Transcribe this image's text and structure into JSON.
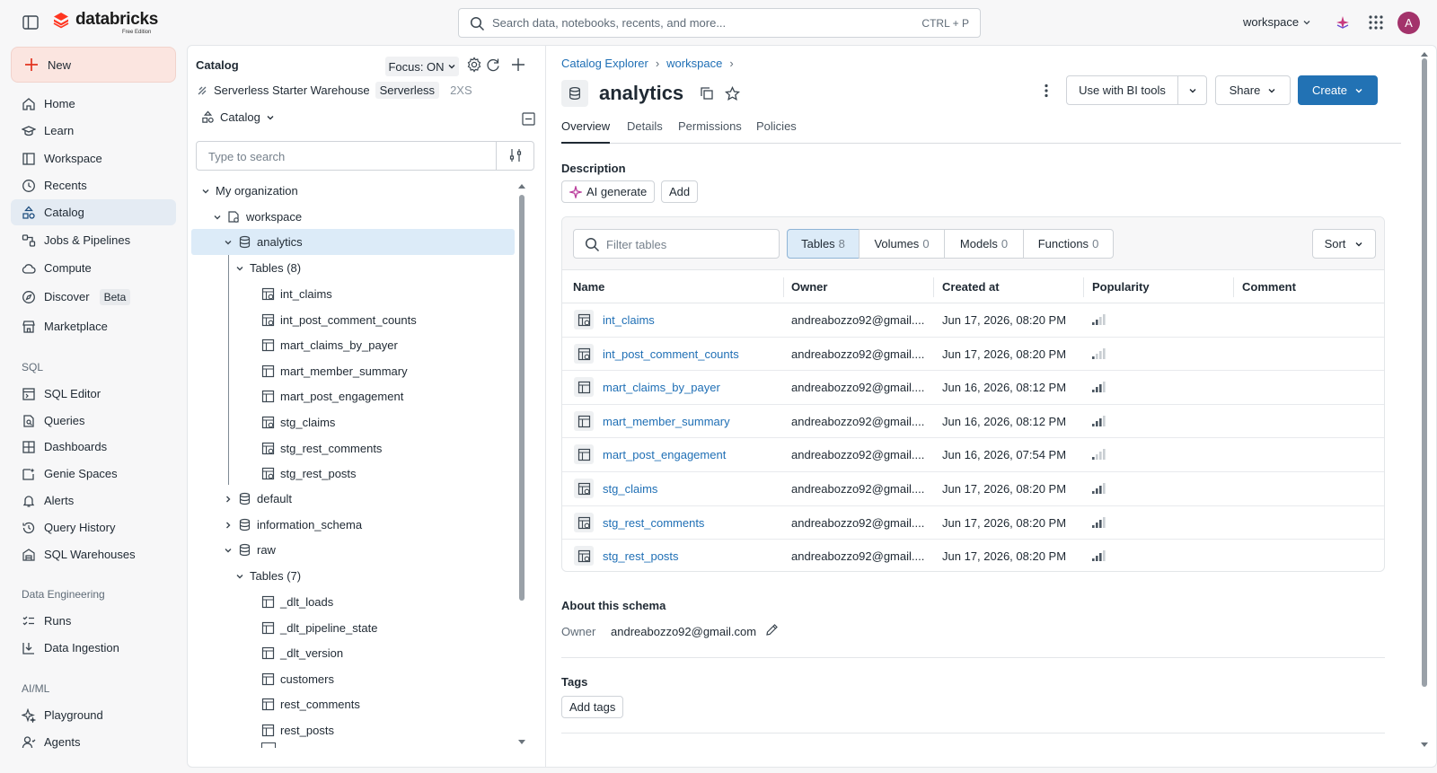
{
  "app": {
    "brand": "databricks",
    "edition": "Free Edition",
    "search_placeholder": "Search data, notebooks, recents, and more...",
    "search_shortcut": "CTRL + P",
    "workspace_label": "workspace",
    "avatar_initial": "A",
    "accent_color": "#2272b4",
    "brand_color": "#ff3621"
  },
  "leftnav": {
    "new_label": "New",
    "items": [
      {
        "label": "Home",
        "icon": "home-icon"
      },
      {
        "label": "Learn",
        "icon": "learn-icon"
      },
      {
        "label": "Workspace",
        "icon": "workspace-icon"
      },
      {
        "label": "Recents",
        "icon": "clock-icon"
      },
      {
        "label": "Catalog",
        "icon": "catalog-icon",
        "active": true
      },
      {
        "label": "Jobs & Pipelines",
        "icon": "jobs-icon"
      },
      {
        "label": "Compute",
        "icon": "cloud-icon"
      },
      {
        "label": "Discover",
        "icon": "compass-icon",
        "badge": "Beta"
      },
      {
        "label": "Marketplace",
        "icon": "store-icon"
      }
    ],
    "sql_section": "SQL",
    "sql_items": [
      {
        "label": "SQL Editor",
        "icon": "sql-editor-icon"
      },
      {
        "label": "Queries",
        "icon": "queries-icon"
      },
      {
        "label": "Dashboards",
        "icon": "dashboard-icon"
      },
      {
        "label": "Genie Spaces",
        "icon": "genie-icon"
      },
      {
        "label": "Alerts",
        "icon": "bell-icon"
      },
      {
        "label": "Query History",
        "icon": "history-icon"
      },
      {
        "label": "SQL Warehouses",
        "icon": "warehouse-icon"
      }
    ],
    "de_section": "Data Engineering",
    "de_items": [
      {
        "label": "Runs",
        "icon": "runs-icon"
      },
      {
        "label": "Data Ingestion",
        "icon": "ingestion-icon"
      }
    ],
    "ml_section": "AI/ML",
    "ml_items": [
      {
        "label": "Playground",
        "icon": "sparkle-icon"
      },
      {
        "label": "Agents",
        "icon": "agents-icon"
      }
    ]
  },
  "catalog_panel": {
    "title": "Catalog",
    "focus_label": "Focus: ON",
    "warehouse_name": "Serverless Starter Warehouse",
    "warehouse_type": "Serverless",
    "warehouse_size": "2XS",
    "catalog_dropdown": "Catalog",
    "search_placeholder": "Type to search",
    "tree": {
      "org": "My organization",
      "workspace": "workspace",
      "analytics": "analytics",
      "analytics_tables_group": "Tables (8)",
      "analytics_tables": [
        "int_claims",
        "int_post_comment_counts",
        "mart_claims_by_payer",
        "mart_member_summary",
        "mart_post_engagement",
        "stg_claims",
        "stg_rest_comments",
        "stg_rest_posts"
      ],
      "default": "default",
      "information_schema": "information_schema",
      "raw": "raw",
      "raw_tables_group": "Tables (7)",
      "raw_tables": [
        "_dlt_loads",
        "_dlt_pipeline_state",
        "_dlt_version",
        "customers",
        "rest_comments",
        "rest_posts"
      ]
    }
  },
  "main": {
    "breadcrumbs": [
      "Catalog Explorer",
      "workspace"
    ],
    "schema_name": "analytics",
    "buttons": {
      "bi_tools": "Use with BI tools",
      "share": "Share",
      "create": "Create"
    },
    "tabs": [
      "Overview",
      "Details",
      "Permissions",
      "Policies"
    ],
    "description_label": "Description",
    "ai_generate": "AI generate",
    "add": "Add",
    "filter_placeholder": "Filter tables",
    "segments": [
      {
        "label": "Tables",
        "count": "8"
      },
      {
        "label": "Volumes",
        "count": "0"
      },
      {
        "label": "Models",
        "count": "0"
      },
      {
        "label": "Functions",
        "count": "0"
      }
    ],
    "sort_label": "Sort",
    "columns": [
      "Name",
      "Owner",
      "Created at",
      "Popularity",
      "Comment"
    ],
    "rows": [
      {
        "name": "int_claims",
        "owner": "andreabozzo92@gmail....",
        "created": "Jun 17, 2026, 08:20 PM",
        "popularity": 2
      },
      {
        "name": "int_post_comment_counts",
        "owner": "andreabozzo92@gmail....",
        "created": "Jun 17, 2026, 08:20 PM",
        "popularity": 1
      },
      {
        "name": "mart_claims_by_payer",
        "owner": "andreabozzo92@gmail....",
        "created": "Jun 16, 2026, 08:12 PM",
        "popularity": 3
      },
      {
        "name": "mart_member_summary",
        "owner": "andreabozzo92@gmail....",
        "created": "Jun 16, 2026, 08:12 PM",
        "popularity": 3
      },
      {
        "name": "mart_post_engagement",
        "owner": "andreabozzo92@gmail....",
        "created": "Jun 16, 2026, 07:54 PM",
        "popularity": 1
      },
      {
        "name": "stg_claims",
        "owner": "andreabozzo92@gmail....",
        "created": "Jun 17, 2026, 08:20 PM",
        "popularity": 3
      },
      {
        "name": "stg_rest_comments",
        "owner": "andreabozzo92@gmail....",
        "created": "Jun 17, 2026, 08:20 PM",
        "popularity": 3
      },
      {
        "name": "stg_rest_posts",
        "owner": "andreabozzo92@gmail....",
        "created": "Jun 17, 2026, 08:20 PM",
        "popularity": 3
      }
    ],
    "about_label": "About this schema",
    "owner_key": "Owner",
    "owner_value": "andreabozzo92@gmail.com",
    "tags_label": "Tags",
    "add_tags": "Add tags"
  }
}
